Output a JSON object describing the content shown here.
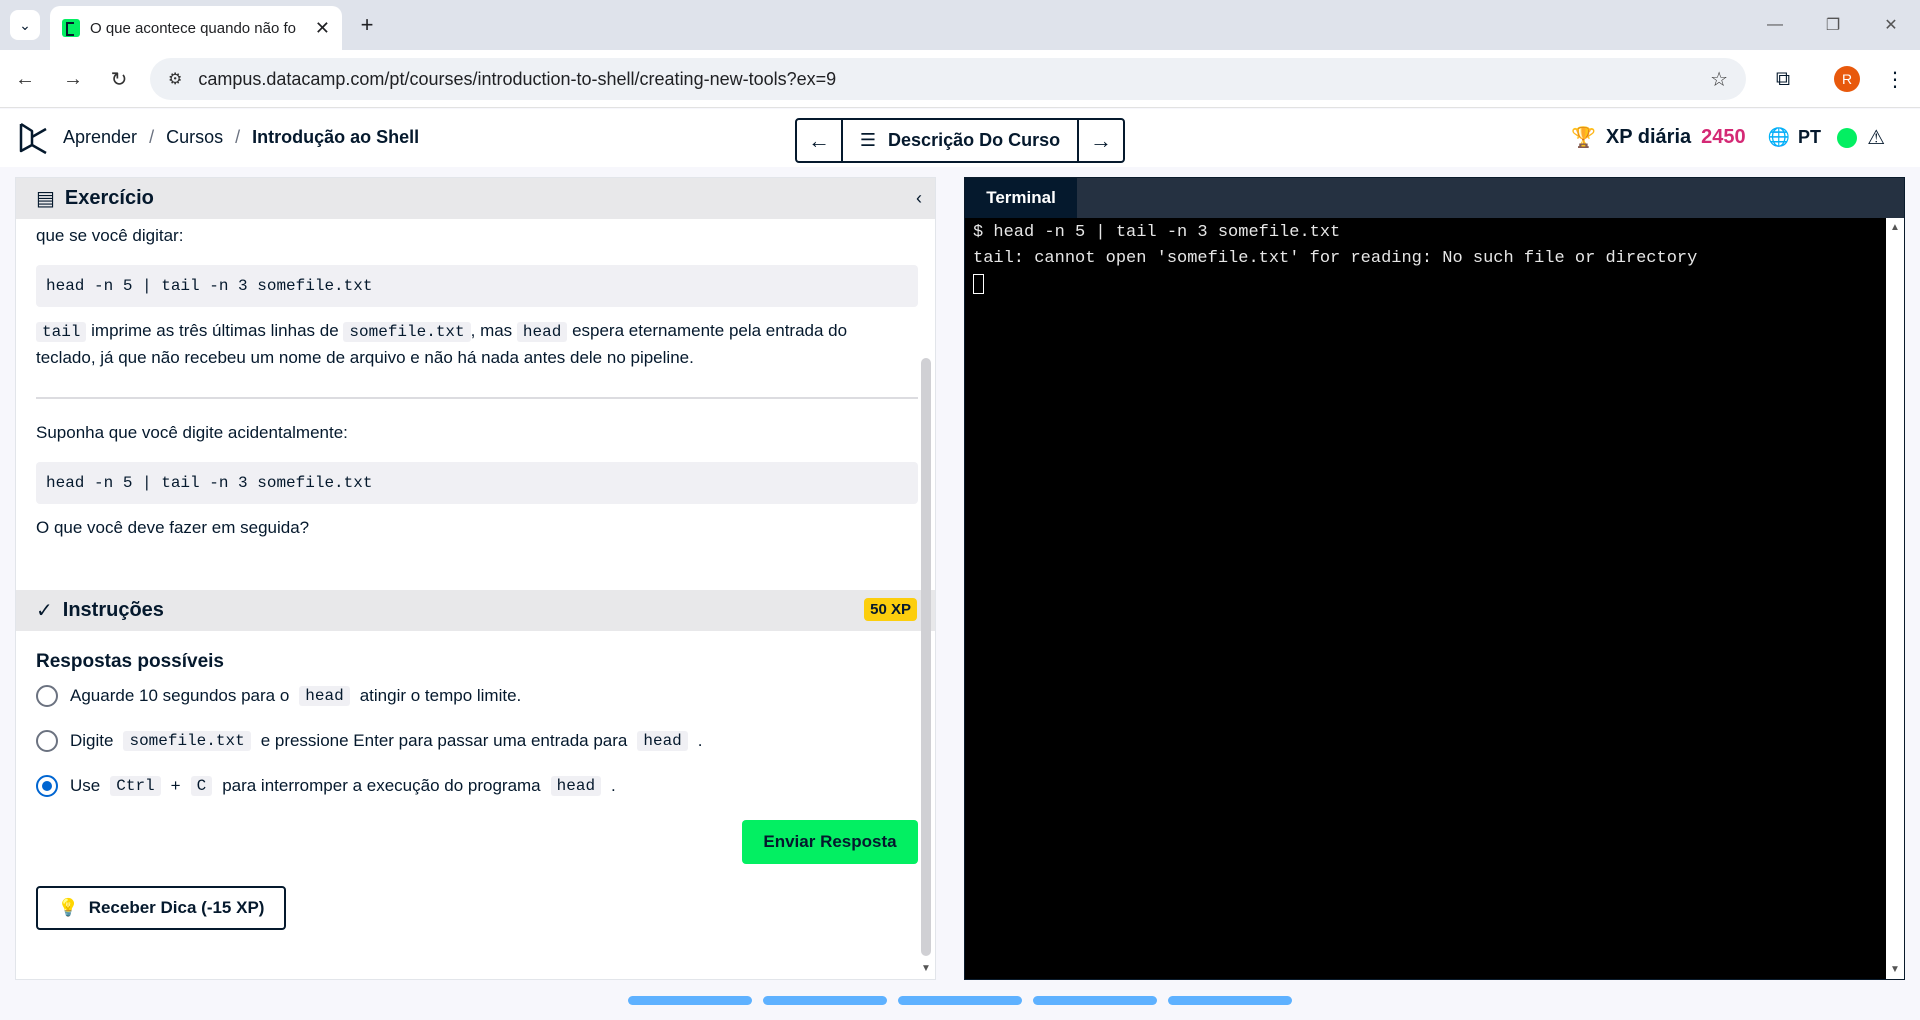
{
  "browser": {
    "tab_title": "O que acontece quando não fo",
    "url": "campus.datacamp.com/pt/courses/introduction-to-shell/creating-new-tools?ex=9",
    "profile_initial": "R"
  },
  "header": {
    "breadcrumbs": [
      "Aprender",
      "Cursos",
      "Introdução ao Shell"
    ],
    "course_desc_label": "Descrição Do Curso",
    "xp_label": "XP diária",
    "xp_value": "2450",
    "language": "PT"
  },
  "exercise": {
    "heading": "Exercício",
    "intro_fragment": "que se você digitar:",
    "code1": "head -n 5 | tail -n 3 somefile.txt",
    "para1": {
      "code_tail": "tail",
      "t1": "imprime as três últimas linhas de",
      "code_file": "somefile.txt",
      "t2": ", mas",
      "code_head": "head",
      "t3": "espera eternamente pela entrada do",
      "line2": "teclado, já que não recebeu um nome de arquivo e não há nada antes dele no pipeline."
    },
    "suppose": "Suponha que você digite acidentalmente:",
    "code2": "head -n 5 | tail -n 3 somefile.txt",
    "question": "O que você deve fazer em seguida?"
  },
  "instructions": {
    "heading": "Instruções",
    "xp_badge": "50 XP",
    "answers_heading": "Respostas possíveis",
    "options": [
      {
        "a": "Aguarde 10 segundos para o",
        "code": "head",
        "b": "atingir o tempo limite.",
        "selected": false
      },
      {
        "a": "Digite",
        "code": "somefile.txt",
        "b": "e pressione Enter para passar uma entrada para",
        "code2": "head",
        "c": ".",
        "selected": false
      },
      {
        "a": "Use",
        "code": "Ctrl",
        "plus": "+",
        "code2": "C",
        "b": "para interromper a execução do programa",
        "code3": "head",
        "c": ".",
        "selected": true
      }
    ],
    "submit_label": "Enviar Resposta",
    "hint_label": "Receber Dica (-15 XP)"
  },
  "terminal": {
    "tab_label": "Terminal",
    "line1": "$ head -n 5 | tail -n 3 somefile.txt",
    "line2": "tail: cannot open 'somefile.txt' for reading: No such file or directory"
  },
  "colors": {
    "accent_green": "#03ef62",
    "xp_pink": "#d42975",
    "badge_yellow": "#fcce0d",
    "radio_blue": "#0065d1",
    "progress_blue": "#5eb1ff"
  }
}
